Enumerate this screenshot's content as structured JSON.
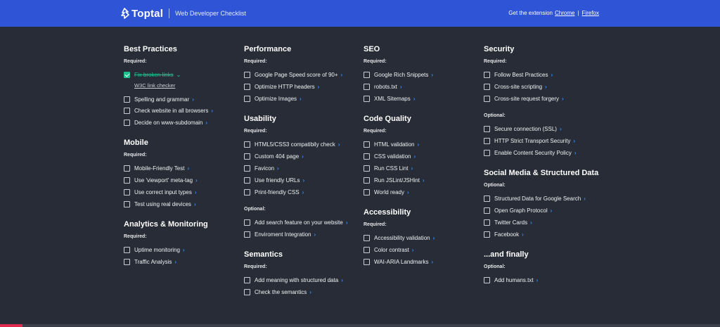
{
  "header": {
    "brand": "Toptal",
    "subtitle": "Web Developer Checklist",
    "extension_prefix": "Get the extension",
    "chrome_link": "Chrome",
    "separator": "|",
    "firefox_link": "Firefox",
    "bg_color": "#2f54d6"
  },
  "colors": {
    "background": "#272c36",
    "accent_link": "#2f8cff",
    "checked": "#1fc08f",
    "footer_accent": "#e0294f"
  },
  "chevron": "›",
  "sections": {
    "best_practices": {
      "title": "Best Practices",
      "required": "Required:",
      "items": [
        {
          "label": "Fix broken links",
          "checked": true
        },
        {
          "label": "Spelling and grammar",
          "checked": false
        },
        {
          "label": "Check website in all browsers",
          "checked": false
        },
        {
          "label": "Decide on www-subdomain",
          "checked": false
        }
      ],
      "expanded_link": "W3C link checker"
    },
    "mobile": {
      "title": "Mobile",
      "required": "Required:",
      "items": [
        {
          "label": "Mobile-Friendly Test",
          "checked": false
        },
        {
          "label": "Use 'viewport' meta-tag",
          "checked": false
        },
        {
          "label": "Use correct input types",
          "checked": false
        },
        {
          "label": "Test using real devices",
          "checked": false
        }
      ]
    },
    "analytics": {
      "title": "Analytics & Monitoring",
      "required": "Required:",
      "items": [
        {
          "label": "Uptime monitoring",
          "checked": false
        },
        {
          "label": "Traffic Analysis",
          "checked": false
        }
      ]
    },
    "performance": {
      "title": "Performance",
      "required": "Required:",
      "items": [
        {
          "label": "Google Page Speed score of 90+",
          "checked": false
        },
        {
          "label": "Optimize HTTP headers",
          "checked": false
        },
        {
          "label": "Optimize Images",
          "checked": false
        }
      ]
    },
    "usability": {
      "title": "Usability",
      "required": "Required:",
      "items": [
        {
          "label": "HTML5/CSS3 compatibily check",
          "checked": false
        },
        {
          "label": "Custom 404 page",
          "checked": false
        },
        {
          "label": "Favicon",
          "checked": false
        },
        {
          "label": "Use friendly URLs",
          "checked": false
        },
        {
          "label": "Print-friendly CSS",
          "checked": false
        }
      ],
      "optional": "Optional:",
      "optional_items": [
        {
          "label": "Add search feature on your website",
          "checked": false
        },
        {
          "label": "Enviroment Integration",
          "checked": false
        }
      ]
    },
    "semantics": {
      "title": "Semantics",
      "required": "Required:",
      "items": [
        {
          "label": "Add meaning with structured data",
          "checked": false
        },
        {
          "label": "Check the semantics",
          "checked": false
        }
      ]
    },
    "seo": {
      "title": "SEO",
      "required": "Required:",
      "items": [
        {
          "label": "Google Rich Snippets",
          "checked": false
        },
        {
          "label": "robots.txt",
          "checked": false
        },
        {
          "label": "XML Sitemaps",
          "checked": false
        }
      ]
    },
    "code_quality": {
      "title": "Code Quality",
      "required": "Required:",
      "items": [
        {
          "label": "HTML validation",
          "checked": false
        },
        {
          "label": "CSS validation",
          "checked": false
        },
        {
          "label": "Run CSS Lint",
          "checked": false
        },
        {
          "label": "Run JSLint/JSHint",
          "checked": false
        },
        {
          "label": "World ready",
          "checked": false
        }
      ]
    },
    "accessibility": {
      "title": "Accessibility",
      "required": "Required:",
      "items": [
        {
          "label": "Accessibility validation",
          "checked": false
        },
        {
          "label": "Color contrast",
          "checked": false
        },
        {
          "label": "WAI-ARIA Landmarks",
          "checked": false
        }
      ]
    },
    "security": {
      "title": "Security",
      "required": "Required:",
      "items": [
        {
          "label": "Follow Best Practices",
          "checked": false
        },
        {
          "label": "Cross-site scripting",
          "checked": false
        },
        {
          "label": "Cross-site request forgery",
          "checked": false
        }
      ],
      "optional": "Optional:",
      "optional_items": [
        {
          "label": "Secure connection (SSL)",
          "checked": false
        },
        {
          "label": "HTTP Strict Transport Security",
          "checked": false
        },
        {
          "label": "Enable Content Security Policy",
          "checked": false
        }
      ]
    },
    "social_media": {
      "title": "Social Media & Structured Data",
      "optional": "Optional:",
      "optional_items": [
        {
          "label": "Structured Data for Google Search",
          "checked": false
        },
        {
          "label": "Open Graph Protocol",
          "checked": false
        },
        {
          "label": "Twitter Cards",
          "checked": false
        },
        {
          "label": "Facebook",
          "checked": false
        }
      ]
    },
    "and_finally": {
      "title": "...and finally",
      "optional": "Optional:",
      "optional_items": [
        {
          "label": "Add humans.txt",
          "checked": false
        }
      ]
    }
  }
}
